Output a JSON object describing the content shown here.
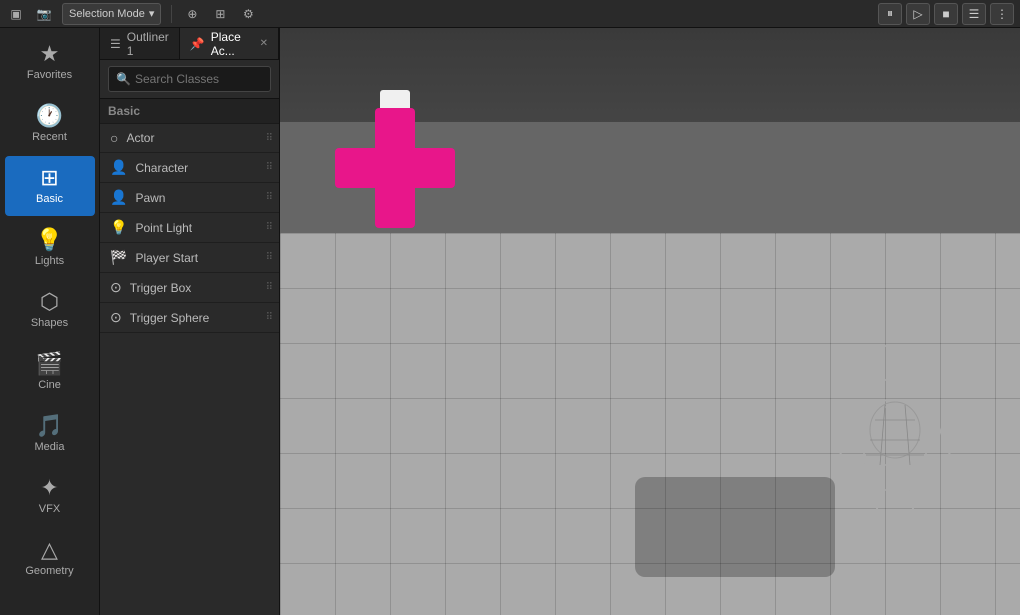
{
  "toolbar": {
    "window_icon": "▣",
    "camera_icon": "📷",
    "selection_mode_label": "Selection Mode",
    "selection_dropdown": "▾",
    "transform_btn": "⊕",
    "grid_btn": "⊞",
    "settings_btn": "⚙",
    "play_btn": "▶",
    "play_from_here_btn": "▷",
    "stop_btn": "■",
    "console_btn": "☰",
    "more_btn": "⋮"
  },
  "panels": {
    "outliner_tab_label": "Outliner 1",
    "place_actors_tab_label": "Place Ac...",
    "search_placeholder": "Search Classes",
    "basic_category": "Basic",
    "classes": [
      {
        "id": "actor",
        "label": "Actor",
        "icon": "○"
      },
      {
        "id": "character",
        "label": "Character",
        "icon": "👤"
      },
      {
        "id": "pawn",
        "label": "Pawn",
        "icon": "👤"
      },
      {
        "id": "point_light",
        "label": "Point Light",
        "icon": "💡"
      },
      {
        "id": "player_start",
        "label": "Player Start",
        "icon": "🏁"
      },
      {
        "id": "trigger_box",
        "label": "Trigger Box",
        "icon": "⊙"
      },
      {
        "id": "trigger_sphere",
        "label": "Trigger Sphere",
        "icon": "⊙"
      }
    ]
  },
  "sidebar": {
    "items": [
      {
        "id": "favorites",
        "label": "Favorites",
        "icon": "★"
      },
      {
        "id": "recent",
        "label": "Recent",
        "icon": "🕐"
      },
      {
        "id": "basic",
        "label": "Basic",
        "icon": "⊞",
        "active": true
      },
      {
        "id": "lights",
        "label": "Lights",
        "icon": "💡"
      },
      {
        "id": "shapes",
        "label": "Shapes",
        "icon": "⬡"
      },
      {
        "id": "cine",
        "label": "Cine",
        "icon": "🎬"
      },
      {
        "id": "media",
        "label": "Media",
        "icon": "🎵"
      },
      {
        "id": "vfx",
        "label": "VFX",
        "icon": "✦"
      },
      {
        "id": "geometry",
        "label": "Geometry",
        "icon": "△"
      }
    ]
  },
  "viewport": {
    "character_visible": true
  }
}
